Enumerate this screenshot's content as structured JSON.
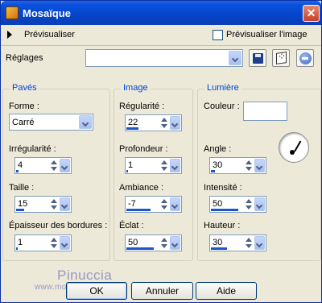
{
  "window": {
    "title": "Mosaïque"
  },
  "preview": {
    "label": "Prévisualiser",
    "checkbox_label": "Prévisualiser l'image",
    "checked": false
  },
  "presets": {
    "label": "Réglages",
    "value": ""
  },
  "groups": {
    "pave": {
      "title": "Pavés",
      "shape_label": "Forme :",
      "shape_value": "Carré",
      "irregularity_label": "Irrégularité :",
      "irregularity_value": "4",
      "irregularity_level": 0.04,
      "size_label": "Taille :",
      "size_value": "15",
      "size_level": 0.15,
      "border_label": "Épaisseur des bordures :",
      "border_value": "1",
      "border_level": 0.01
    },
    "image": {
      "title": "Image",
      "regularity_label": "Régularité :",
      "regularity_value": "22",
      "regularity_level": 0.22,
      "depth_label": "Profondeur :",
      "depth_value": "1",
      "depth_level": 0.01,
      "ambiance_label": "Ambiance :",
      "ambiance_value": "-7",
      "ambiance_level": 0.45,
      "flash_label": "Éclat :",
      "flash_value": "50",
      "flash_level": 0.5
    },
    "light": {
      "title": "Lumière",
      "color_label": "Couleur :",
      "color_value": "#ffffff",
      "angle_label": "Angle :",
      "angle_value": "30",
      "angle_level": 0.08,
      "intensity_label": "Intensité :",
      "intensity_value": "50",
      "intensity_level": 0.5,
      "height_label": "Hauteur :",
      "height_value": "30",
      "height_level": 0.3
    }
  },
  "buttons": {
    "ok": "OK",
    "cancel": "Annuler",
    "help": "Aide"
  },
  "watermark": {
    "name": "Pinuccia",
    "url": "www.modifiesgrafica.eu"
  },
  "icons": {
    "app": "app-icon",
    "close": "close-icon",
    "triangle": "triangle-right-icon",
    "save": "floppy-save-icon",
    "random": "dice-random-icon",
    "reset": "reset-icon",
    "dial": "angle-dial-icon"
  },
  "colors": {
    "title_bar": "#0544c9",
    "group_title": "#0046d5",
    "bar": "#1b55c8"
  }
}
